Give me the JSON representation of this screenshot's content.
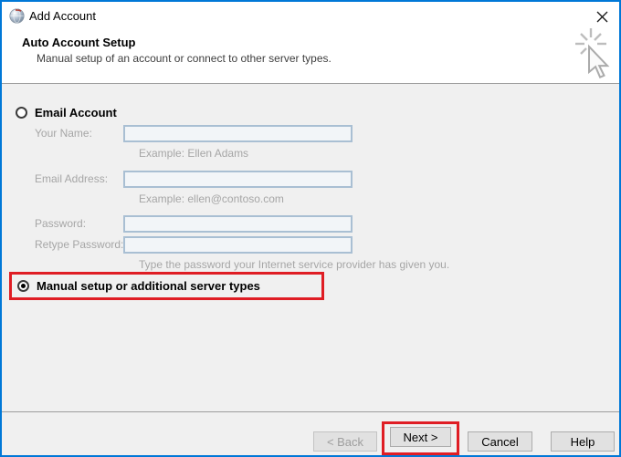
{
  "window": {
    "title": "Add Account"
  },
  "header": {
    "title": "Auto Account Setup",
    "subtitle": "Manual setup of an account or connect to other server types."
  },
  "form": {
    "email_account_label": "Email Account",
    "fields": [
      {
        "label": "Your Name:",
        "value": "",
        "hint": "Example: Ellen Adams"
      },
      {
        "label": "Email Address:",
        "value": "",
        "hint": "Example: ellen@contoso.com"
      },
      {
        "label": "Password:",
        "value": ""
      },
      {
        "label": "Retype Password:",
        "value": "",
        "hint": "Type the password your Internet service provider has given you."
      }
    ],
    "manual_setup_label": "Manual setup or additional server types"
  },
  "footer": {
    "back_label": "< Back",
    "next_label": "Next >",
    "cancel_label": "Cancel",
    "help_label": "Help"
  },
  "colors": {
    "window_border": "#0078d7",
    "highlight_box": "#df1d24",
    "body_bg": "#f0f0f0",
    "header_bg": "#ffffff",
    "input_border": "#a9bfd3",
    "disabled_text": "#a6a6a6",
    "button_bg": "#e1e1e1"
  }
}
